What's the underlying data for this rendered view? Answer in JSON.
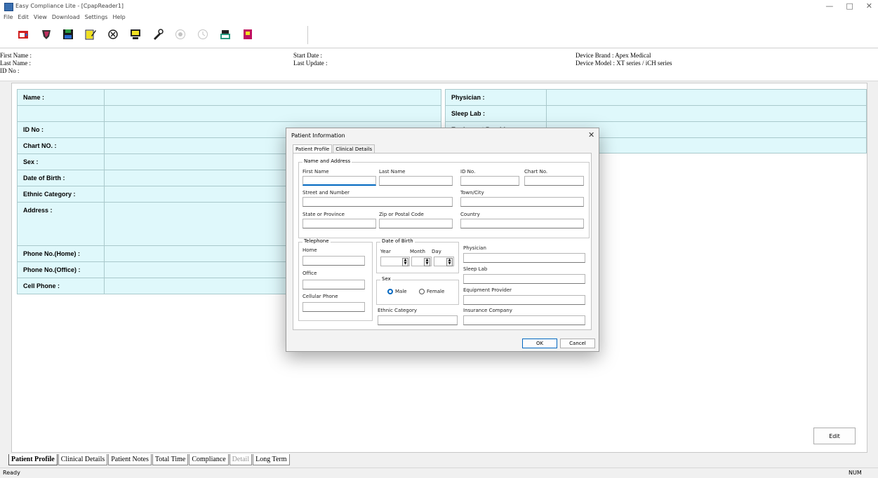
{
  "window": {
    "title": "Easy Compliance Lite - [CpapReader1]",
    "minimize": "—",
    "maximize": "□",
    "close": "✕"
  },
  "menu": [
    "File",
    "Edit",
    "View",
    "Download",
    "Settings",
    "Help"
  ],
  "toolbar": {
    "icons": [
      "open-record-icon",
      "heart-shield-icon",
      "save-disk-icon",
      "edit-notepad-icon",
      "card-reader-icon",
      "monitor-icon",
      "tools-icon",
      "camera-icon",
      "clock-icon",
      "phone-modem-icon",
      "book-icon"
    ]
  },
  "header": {
    "first_name": "First Name :",
    "last_name": "Last Name :",
    "id_no": "ID No :",
    "start_date": "Start Date :",
    "last_update": "Last Update :",
    "device_brand": "Device Brand : Apex Medical",
    "device_model": "Device Model : XT series / iCH series"
  },
  "profile": {
    "left_labels": [
      "Name :",
      "",
      "ID No :",
      "Chart NO. :",
      "Sex :",
      "Date of Birth :",
      "Ethnic Category :",
      "Address :",
      "Phone No.(Home) :",
      "Phone No.(Office) :",
      "Cell Phone :"
    ],
    "right_labels": [
      "Physician :",
      "Sleep Lab :",
      "Equipment Provider :",
      ""
    ]
  },
  "edit_button": "Edit",
  "bottom_tabs": [
    "Patient Profile",
    "Clinical Details",
    "Patient Notes",
    "Total Time",
    "Compliance",
    "Detail",
    "Long Term"
  ],
  "status": {
    "left": "Ready",
    "right": "NUM"
  },
  "dialog": {
    "title": "Patient Information",
    "close": "✕",
    "tabs": [
      "Patient Profile",
      "Clinical Details"
    ],
    "name_address": {
      "group": "Name and Address",
      "first_name": "First Name",
      "last_name": "Last Name",
      "id_no": "ID No.",
      "chart_no": "Chart No.",
      "street": "Street and Number",
      "town": "Town/City",
      "state": "State or Province",
      "zip": "Zip or Postal Code",
      "country": "Country"
    },
    "telephone": {
      "group": "Telephone",
      "home": "Home",
      "office": "Office",
      "cellular": "Cellular Phone"
    },
    "dob": {
      "group": "Date of Birth",
      "year": "Year",
      "month": "Month",
      "day": "Day"
    },
    "sex": {
      "group": "Sex",
      "male": "Male",
      "female": "Female",
      "selected": "Male"
    },
    "ethnic": "Ethnic Category",
    "physician": "Physician",
    "sleep_lab": "Sleep Lab",
    "equipment_provider": "Equipment Provider",
    "insurance": "Insurance Company",
    "ok": "OK",
    "cancel": "Cancel"
  }
}
